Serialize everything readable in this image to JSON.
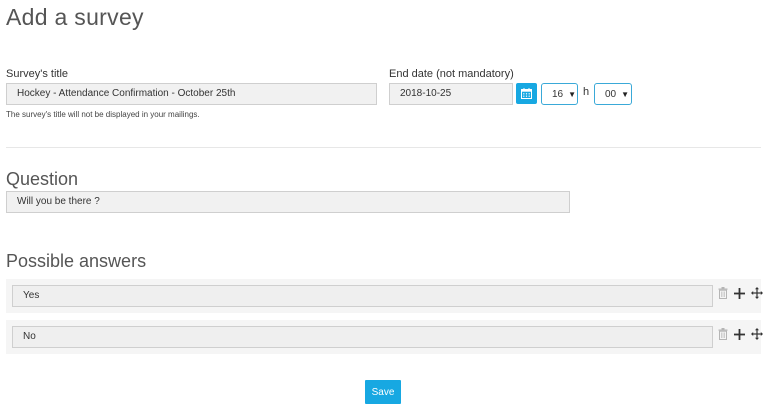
{
  "page": {
    "title": "Add a survey"
  },
  "survey_title": {
    "label": "Survey's title",
    "value": "Hockey - Attendance Confirmation - October 25th",
    "hint": "The survey's title will not be displayed in your mailings."
  },
  "end_date": {
    "label": "End date (not mandatory)",
    "value": "2018-10-25",
    "hour": "16",
    "hour_suffix": "h",
    "minute": "00",
    "caret": "▼"
  },
  "question": {
    "heading": "Question",
    "value": "Will you be there ?"
  },
  "answers": {
    "heading": "Possible answers",
    "items": [
      {
        "value": "Yes"
      },
      {
        "value": "No"
      }
    ]
  },
  "actions": {
    "save_label": "Save"
  },
  "colors": {
    "accent": "#17a8e2",
    "select_border": "#3aa9d8",
    "input_bg": "#f1f1f1"
  },
  "icons": [
    "calendar-icon",
    "trash-icon",
    "plus-icon",
    "move-icon"
  ]
}
